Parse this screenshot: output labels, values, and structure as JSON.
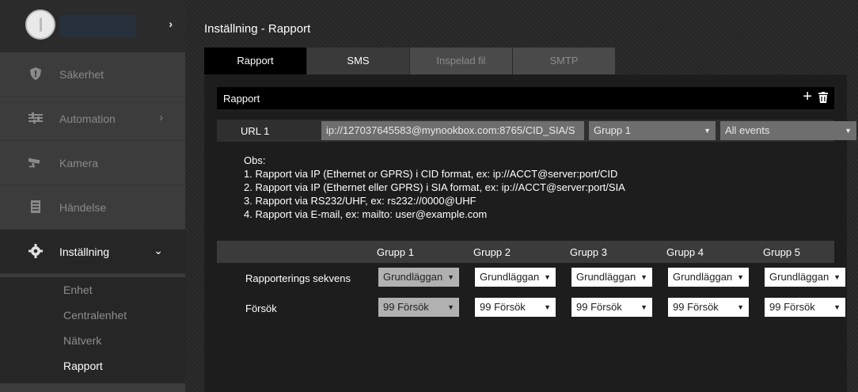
{
  "sidebar": {
    "items": [
      {
        "label": "Säkerhet"
      },
      {
        "label": "Automation"
      },
      {
        "label": "Kamera"
      },
      {
        "label": "Händelse"
      },
      {
        "label": "Inställning"
      }
    ],
    "submenu": [
      "Enhet",
      "Centralenhet",
      "Nätverk",
      "Rapport"
    ]
  },
  "page": {
    "title": "Inställning - Rapport"
  },
  "tabs": [
    "Rapport",
    "SMS",
    "Inspelad fil",
    "SMTP"
  ],
  "panel": {
    "title": "Rapport",
    "url_label": "URL 1",
    "url_value": "ip://127037645583@mynookbox.com:8765/CID_SIA/S",
    "group_select": "Grupp 1",
    "events_select": "All events",
    "notes": [
      "Obs:",
      "1. Rapport via IP (Ethernet or GPRS) i CID format, ex: ip://ACCT@server:port/CID",
      "2. Rapport via IP (Ethernet eller GPRS) i SIA format, ex: ip://ACCT@server:port/SIA",
      "3. Rapport via RS232/UHF, ex: rs232://0000@UHF",
      "4. Rapport via E-mail, ex: mailto: user@example.com"
    ]
  },
  "grid": {
    "columns": [
      "Grupp 1",
      "Grupp 2",
      "Grupp 3",
      "Grupp 4",
      "Grupp 5"
    ],
    "rows": [
      {
        "label": "Rapporterings sekvens",
        "values": [
          "Grundläggan",
          "Grundläggan",
          "Grundläggan",
          "Grundläggan",
          "Grundläggan"
        ]
      },
      {
        "label": "Försök",
        "values": [
          "99 Försök",
          "99 Försök",
          "99 Försök",
          "99 Försök",
          "99 Försök"
        ]
      }
    ]
  }
}
